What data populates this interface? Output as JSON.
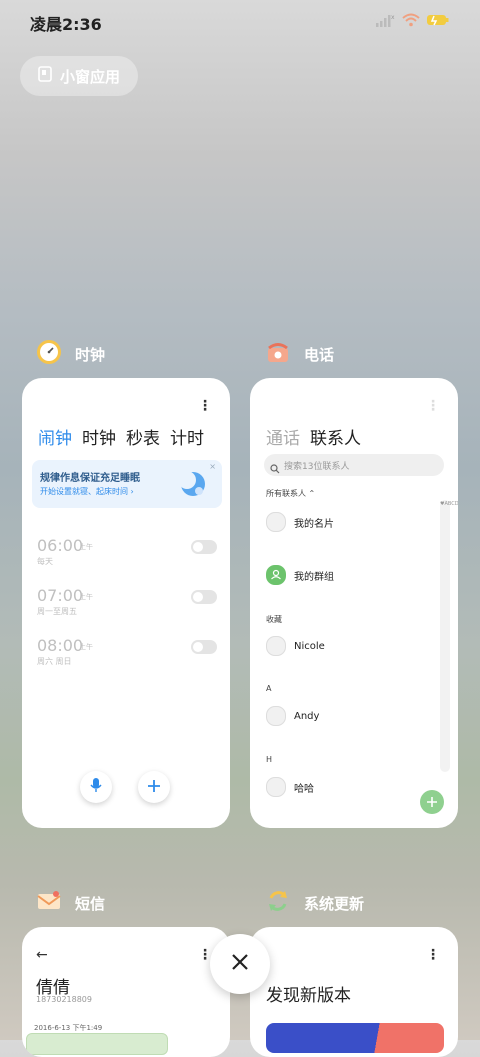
{
  "status_bar": {
    "time": "凌晨2:36",
    "icons": [
      "signal-icon",
      "wifi-icon",
      "battery-icon"
    ]
  },
  "float_window": {
    "label": "小窗应用",
    "icon": "window-icon"
  },
  "apps": [
    {
      "name": "时钟",
      "icon": "clock-icon"
    },
    {
      "name": "电话",
      "icon": "phone-icon"
    },
    {
      "name": "短信",
      "icon": "sms-icon"
    },
    {
      "name": "系统更新",
      "icon": "update-icon"
    }
  ],
  "clock": {
    "tabs": [
      "闹钟",
      "时钟",
      "秒表",
      "计时"
    ],
    "active_tab": "闹钟",
    "banner": {
      "title": "规律作息保证充足睡眠",
      "subtitle": "开始设置就寝、起床时间"
    },
    "alarms": [
      {
        "time": "06:00",
        "ampm": "上午",
        "repeat": "每天",
        "enabled": false
      },
      {
        "time": "07:00",
        "ampm": "上午",
        "repeat": "周一至周五",
        "enabled": false
      },
      {
        "time": "08:00",
        "ampm": "上午",
        "repeat": "周六 周日",
        "enabled": false
      }
    ],
    "accent": "#2e8bea"
  },
  "phone": {
    "tabs": [
      "通话",
      "联系人"
    ],
    "active_tab": "联系人",
    "search_placeholder": "搜索13位联系人",
    "all_contacts": "所有联系人",
    "my_card": "我的名片",
    "my_groups": "我的群组",
    "favorites": "收藏",
    "contacts": [
      {
        "section": "",
        "name": "Nicole"
      },
      {
        "section": "A",
        "name": "Andy"
      },
      {
        "section": "H",
        "name": "哈哈"
      }
    ],
    "alphabet": "♥ABCDEFGHIJKLMNOPQRSTUVWXYZ#",
    "fab_color": "#8fd08f"
  },
  "sms": {
    "contact_name": "倩倩",
    "number": "18730218809",
    "timestamp": "2016-6-13 下午1:49"
  },
  "update": {
    "title": "发现新版本"
  }
}
